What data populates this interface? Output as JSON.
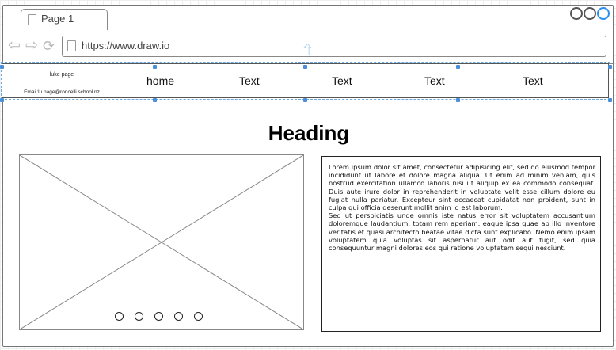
{
  "browser": {
    "tab_title": "Page 1",
    "url": "https://www.draw.io",
    "nav_icons": [
      "back-arrow-icon",
      "forward-arrow-icon",
      "reload-icon"
    ],
    "window_controls": [
      "minimize-icon",
      "maximize-icon",
      "close-icon"
    ]
  },
  "header": {
    "brand_name": "luke page",
    "email": "Email:lu.page@roncelli.school.nz",
    "nav_items": [
      "home",
      "Text",
      "Text",
      "Text",
      "Text"
    ],
    "selection_color": "#4a90d9"
  },
  "main": {
    "heading": "Heading",
    "image_placeholder": "image-placeholder-x",
    "carousel_dots": 5,
    "paragraph_1": "Lorem ipsum dolor sit amet, consectetur adipisicing elit, sed do eiusmod tempor incididunt ut labore et dolore magna aliqua. Ut enim ad minim veniam, quis nostrud exercitation ullamco laboris nisi ut aliquip ex ea commodo consequat. Duis aute irure dolor in reprehenderit in voluptate velit esse cillum dolore eu fugiat nulla pariatur. Excepteur sint occaecat cupidatat non proident, sunt in culpa qui officia deserunt mollit anim id est laborum.",
    "paragraph_2": "Sed ut perspiciatis unde omnis iste natus error sit voluptatem accusantium doloremque laudantium, totam rem aperiam, eaque ipsa quae ab illo inventore veritatis et quasi architecto beatae vitae dicta sunt explicabo. Nemo enim ipsam voluptatem quia voluptas sit aspernatur aut odit aut fugit, sed quia consequuntur magni dolores eos qui ratione voluptatem sequi nesciunt."
  }
}
